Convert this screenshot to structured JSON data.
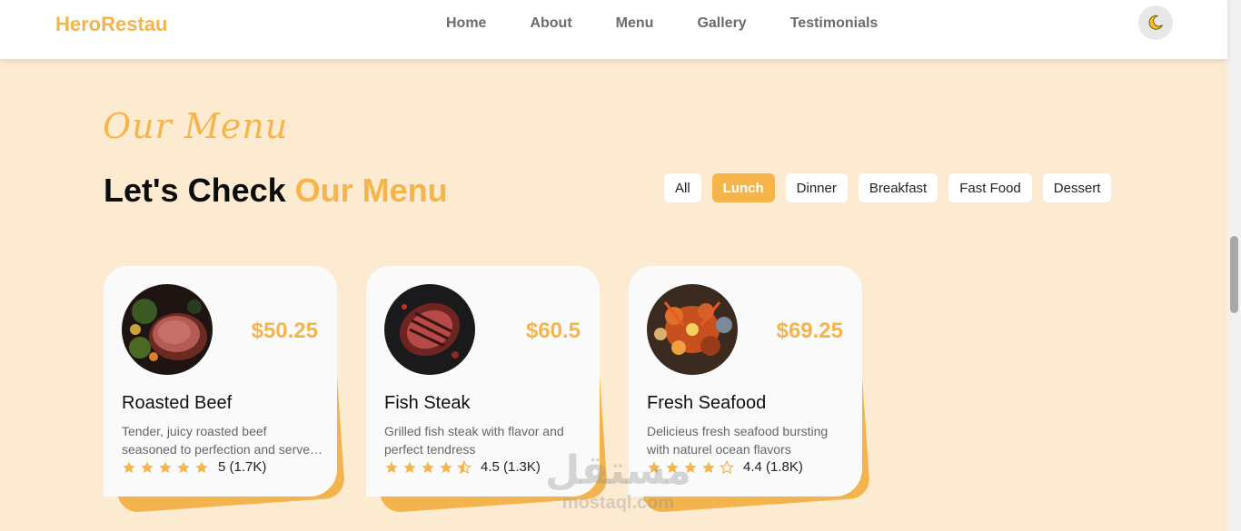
{
  "brand": {
    "name": "HeroRestau",
    "accent": "#f5b54a"
  },
  "nav": {
    "links": [
      "Home",
      "About",
      "Menu",
      "Gallery",
      "Testimonials"
    ],
    "theme_icon": "moon-icon"
  },
  "section": {
    "script_title": "Our Menu",
    "heading_main": "Let's Check ",
    "heading_accent": "Our Menu"
  },
  "filters": {
    "items": [
      "All",
      "Lunch",
      "Dinner",
      "Breakfast",
      "Fast Food",
      "Dessert"
    ],
    "active": "Lunch"
  },
  "cards": [
    {
      "title": "Roasted Beef",
      "price": "$50.25",
      "desc": "Tender, juicy roasted beef seasoned to perfection and served with vegetables",
      "rating": 5,
      "rating_text": "5 (1.7K)",
      "image_icon": "roasted-beef-photo"
    },
    {
      "title": "Fish Steak",
      "price": "$60.5",
      "desc": "Grilled fish steak with flavor and perfect tendress",
      "rating": 4.5,
      "rating_text": "4.5 (1.3K)",
      "image_icon": "fish-steak-photo"
    },
    {
      "title": "Fresh Seafood",
      "price": "$69.25",
      "desc": "Delicieus fresh seafood bursting with naturel ocean flavors",
      "rating": 4.4,
      "rating_text": "4.4 (1.8K)",
      "image_icon": "seafood-photo"
    }
  ],
  "watermark": {
    "arabic": "مستقل",
    "latin": "mostaql.com"
  }
}
